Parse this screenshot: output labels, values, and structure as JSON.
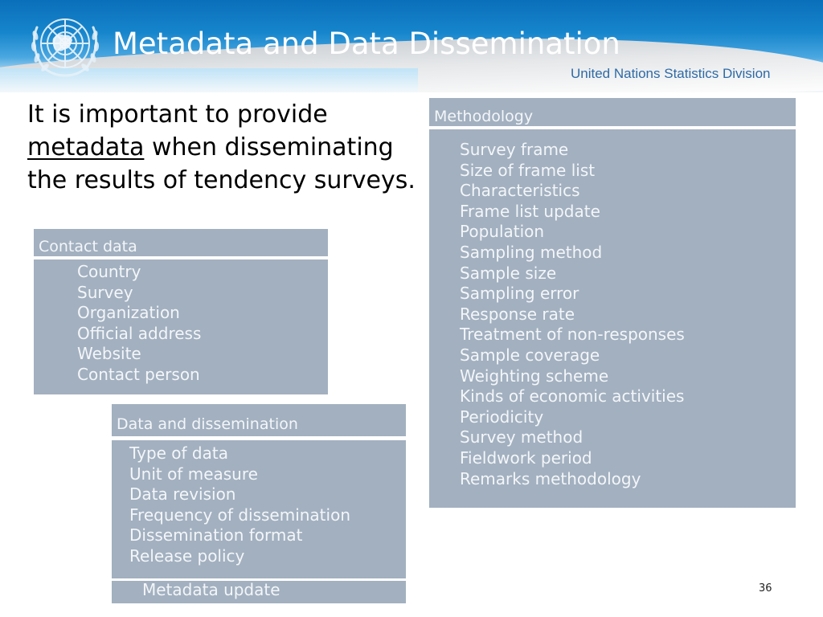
{
  "header": {
    "title": "Metadata and Data Dissemination",
    "organization": "United Nations Statistics Division",
    "logo_icon": "un-emblem-icon",
    "colors": {
      "banner_blue": "#0a6fba",
      "division_text": "#2e6aa6",
      "box_fill": "#a2b0c0"
    }
  },
  "intro": {
    "before": "It is important to provide",
    "emphasis": "metadata",
    "after": "when disseminating the results of tendency surveys."
  },
  "contact_data": {
    "heading": "Contact data",
    "items": [
      "Country",
      "Survey",
      "Organization",
      "Official address",
      "Website",
      "Contact person"
    ]
  },
  "data_dissemination": {
    "heading": "Data and dissemination",
    "items": [
      "Type of data",
      "Unit of measure",
      "Data revision",
      "Frequency of dissemination",
      "Dissemination format",
      "Release policy"
    ],
    "footer": "Metadata update"
  },
  "methodology": {
    "heading": "Methodology",
    "items": [
      "Survey frame",
      "Size of frame list",
      "Characteristics",
      "Frame list update",
      "Population",
      "Sampling method",
      "Sample size",
      "Sampling error",
      "Response rate",
      "Treatment of non-responses",
      "Sample coverage",
      "Weighting scheme",
      "Kinds of economic activities",
      "Periodicity",
      "Survey method",
      "Fieldwork period",
      "Remarks methodology"
    ]
  },
  "page_number": "36"
}
